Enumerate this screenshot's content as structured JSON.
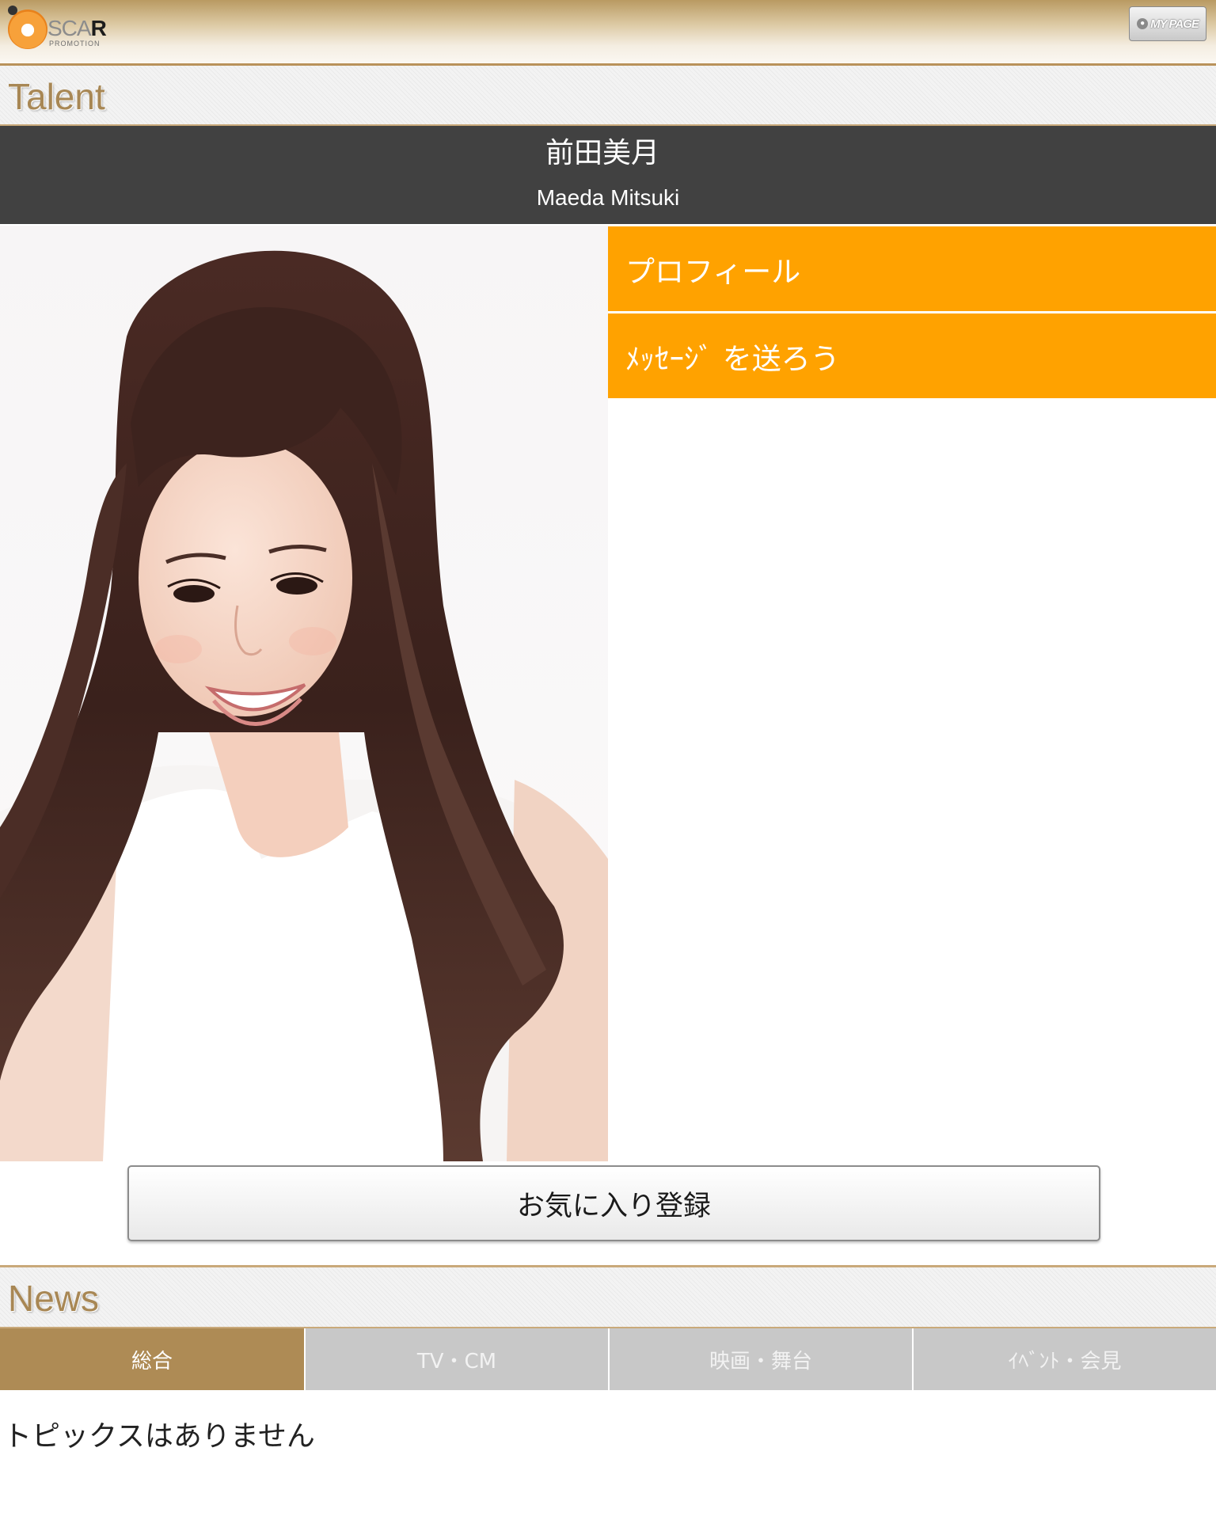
{
  "header": {
    "logo_text_light": "SCA",
    "logo_text_bold": "R",
    "logo_sub": "PROMOTION",
    "mypage_label": "MY PAGE"
  },
  "talent_section": {
    "title": "Talent",
    "name_jp": "前田美月",
    "name_en": "Maeda Mitsuki"
  },
  "menu": {
    "items": [
      {
        "label": "プロフィール"
      },
      {
        "label": "ﾒｯｾｰｼﾞ を送ろう"
      }
    ]
  },
  "favorite_button_label": "お気に入り登録",
  "news_section": {
    "title": "News",
    "tabs": [
      {
        "label": "総合",
        "active": true
      },
      {
        "label": "TV・CM",
        "active": false
      },
      {
        "label": "映画・舞台",
        "active": false
      },
      {
        "label": "ｲﾍﾞﾝﾄ・会見",
        "active": false
      }
    ],
    "empty_message": "トピックスはありません"
  },
  "colors": {
    "accent_orange": "#ffa200",
    "gold": "#ae8b55",
    "banner_dark": "#414141",
    "tab_inactive": "#c8c8c8"
  }
}
